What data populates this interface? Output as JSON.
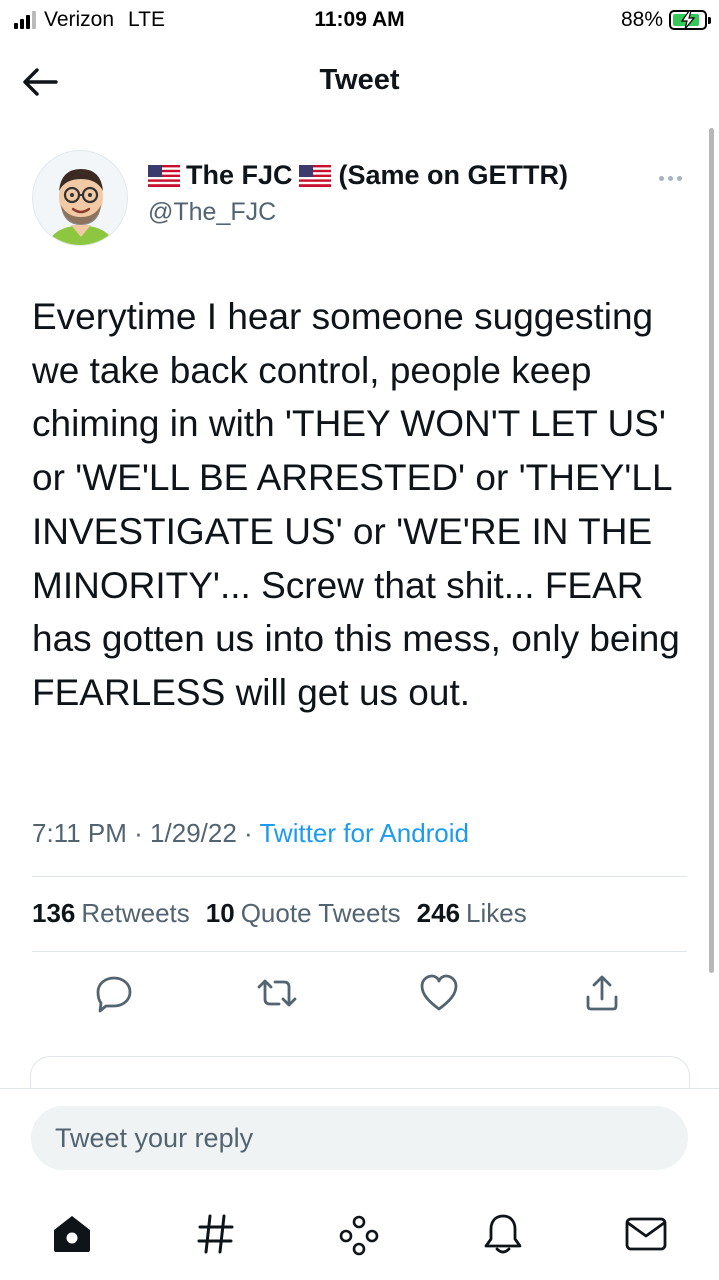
{
  "status_bar": {
    "carrier": "Verizon",
    "network": "LTE",
    "time": "11:09 AM",
    "battery_percent": "88%",
    "battery_level": 0.88
  },
  "header": {
    "title": "Tweet",
    "back_icon": "arrow-left-icon"
  },
  "tweet": {
    "display_name": "The FJC",
    "display_suffix": "(Same on GETTR)",
    "handle": "@The_FJC",
    "text": "Everytime I hear someone suggesting we take back control, people keep chiming in with 'THEY WON'T LET US' or 'WE'LL BE ARRESTED' or 'THEY'LL INVESTIGATE US' or 'WE'RE IN THE MINORITY'... Screw that shit... FEAR has gotten us into this mess, only being FEARLESS will get us out.",
    "time": "7:11 PM",
    "date": "1/29/22",
    "separator": "·",
    "source": "Twitter for Android",
    "stats": {
      "retweets_count": "136",
      "retweets_label": "Retweets",
      "quotes_count": "10",
      "quotes_label": "Quote Tweets",
      "likes_count": "246",
      "likes_label": "Likes"
    },
    "actions": [
      "reply-icon",
      "retweet-icon",
      "like-icon",
      "share-icon"
    ]
  },
  "reply": {
    "placeholder": "Tweet your reply"
  },
  "bottom_nav": [
    "home-icon",
    "explore-hashtag-icon",
    "spaces-icon",
    "notifications-icon",
    "messages-icon"
  ],
  "colors": {
    "accent": "#1d9bf0",
    "text_primary": "#0f1419",
    "text_secondary": "#536471",
    "battery": "#35c759"
  }
}
